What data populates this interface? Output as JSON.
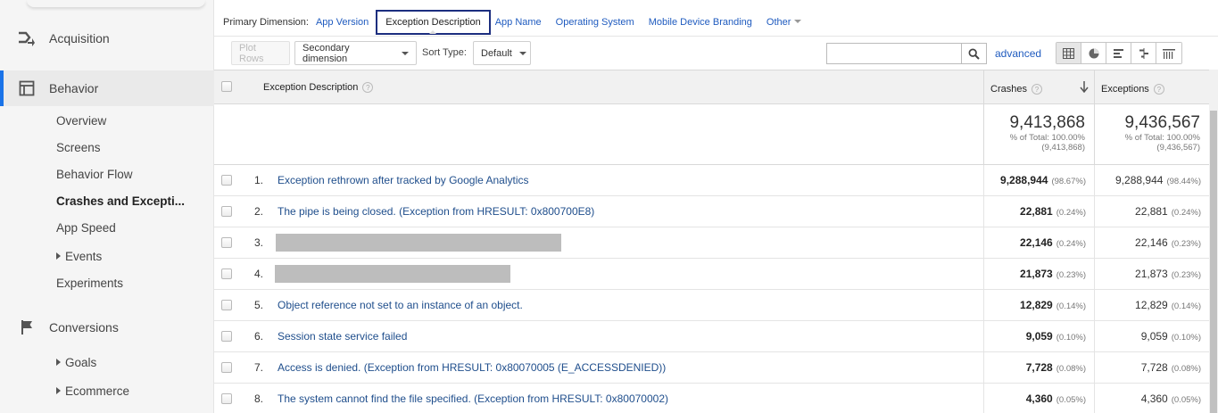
{
  "sidebar": {
    "sections": [
      {
        "label": "Acquisition",
        "icon": "acquisition-icon"
      },
      {
        "label": "Behavior",
        "icon": "behavior-icon",
        "active": true
      },
      {
        "label": "Conversions",
        "icon": "flag-icon"
      }
    ],
    "behavior_items": [
      "Overview",
      "Screens",
      "Behavior Flow",
      "Crashes and Excepti...",
      "App Speed",
      "Events",
      "Experiments"
    ],
    "conversion_items": [
      "Goals",
      "Ecommerce"
    ]
  },
  "dimensions": {
    "label": "Primary Dimension:",
    "items": [
      "App Version",
      "Exception Description",
      "App Name",
      "Operating System",
      "Mobile Device Branding",
      "Other"
    ],
    "selected": "Exception Description"
  },
  "toolbar": {
    "plot_rows": "Plot Rows",
    "secondary_dimension": "Secondary dimension",
    "sort_type_label": "Sort Type:",
    "sort_type_value": "Default",
    "search_value": "",
    "advanced": "advanced"
  },
  "table": {
    "headers": {
      "description": "Exception Description",
      "crashes": "Crashes",
      "exceptions": "Exceptions",
      "help": "?"
    },
    "totals": {
      "crashes": {
        "value": "9,413,868",
        "pct": "% of Total: 100.00%",
        "abs": "(9,413,868)"
      },
      "exceptions": {
        "value": "9,436,567",
        "pct": "% of Total: 100.00%",
        "abs": "(9,436,567)"
      }
    },
    "rows": [
      {
        "n": "1.",
        "desc": "Exception rethrown after tracked by Google Analytics",
        "crashes": "9,288,944",
        "crashes_pct": "(98.67%)",
        "exceptions": "9,288,944",
        "exceptions_pct": "(98.44%)"
      },
      {
        "n": "2.",
        "desc": "The pipe is being closed. (Exception from HRESULT: 0x800700E8)",
        "crashes": "22,881",
        "crashes_pct": "(0.24%)",
        "exceptions": "22,881",
        "exceptions_pct": "(0.24%)"
      },
      {
        "n": "3.",
        "desc": "",
        "crashes": "22,146",
        "crashes_pct": "(0.24%)",
        "exceptions": "22,146",
        "exceptions_pct": "(0.23%)"
      },
      {
        "n": "4.",
        "desc": "",
        "crashes": "21,873",
        "crashes_pct": "(0.23%)",
        "exceptions": "21,873",
        "exceptions_pct": "(0.23%)"
      },
      {
        "n": "5.",
        "desc": "Object reference not set to an instance of an object.",
        "crashes": "12,829",
        "crashes_pct": "(0.14%)",
        "exceptions": "12,829",
        "exceptions_pct": "(0.14%)"
      },
      {
        "n": "6.",
        "desc": "Session state service failed",
        "crashes": "9,059",
        "crashes_pct": "(0.10%)",
        "exceptions": "9,059",
        "exceptions_pct": "(0.10%)"
      },
      {
        "n": "7.",
        "desc": "Access is denied. (Exception from HRESULT: 0x80070005 (E_ACCESSDENIED))",
        "crashes": "7,728",
        "crashes_pct": "(0.08%)",
        "exceptions": "7,728",
        "exceptions_pct": "(0.08%)"
      },
      {
        "n": "8.",
        "desc": "The system cannot find the file specified. (Exception from HRESULT: 0x80070002)",
        "crashes": "4,360",
        "crashes_pct": "(0.05%)",
        "exceptions": "4,360",
        "exceptions_pct": "(0.05%)"
      }
    ]
  },
  "colors": {
    "link": "#1f5bbf",
    "selected_border": "#1c2e7f",
    "active_bar": "#1a73e8"
  }
}
